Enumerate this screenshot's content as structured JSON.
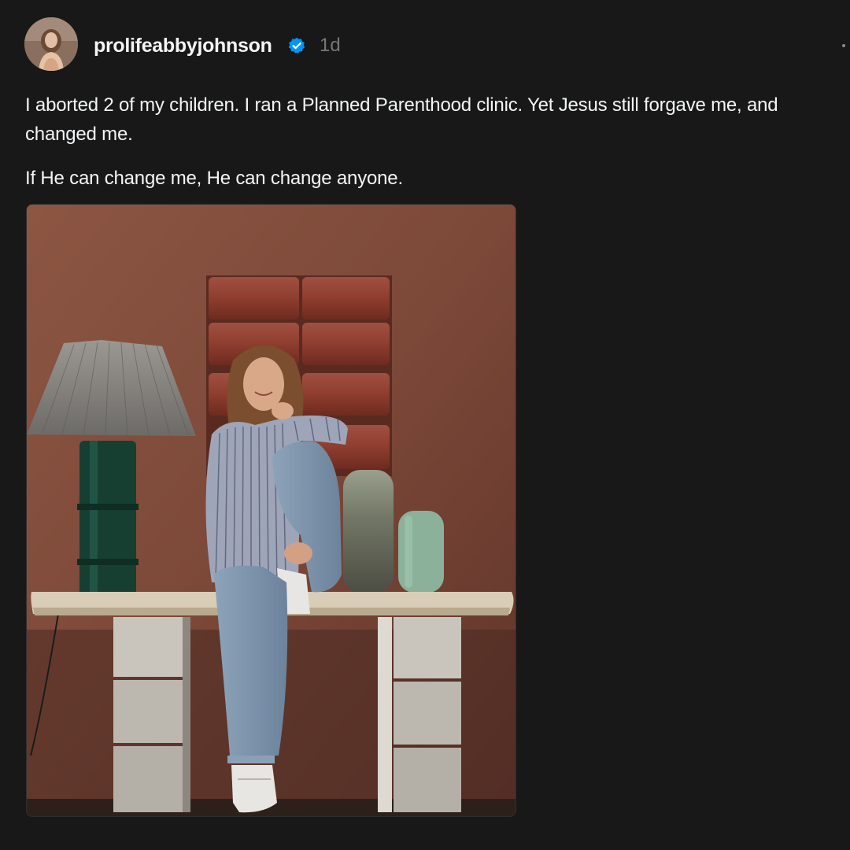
{
  "post": {
    "username": "prolifeabbyjohnson",
    "verified": true,
    "timestamp": "1d",
    "paragraphs": [
      "I aborted 2 of my children. I ran a Planned Parenthood clinic. Yet Jesus still forgave me, and changed me.",
      "If He can change me, He can change anyone."
    ]
  },
  "icons": {
    "verified": "verified-badge-icon",
    "more": "more-options-icon"
  },
  "colors": {
    "background": "#181818",
    "text": "#f3f5f7",
    "muted": "#777777",
    "verified": "#0095f6"
  }
}
